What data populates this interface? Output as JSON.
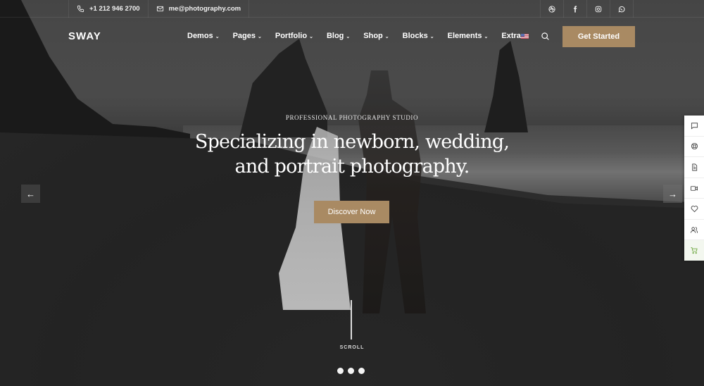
{
  "topbar": {
    "phone": {
      "icon": "phone-icon",
      "text": "+1 212 946 2700"
    },
    "email": {
      "icon": "envelope-icon",
      "text": "me@photography.com"
    },
    "socials": [
      {
        "icon": "dribbble-icon",
        "label": "Dribbble"
      },
      {
        "icon": "facebook-icon",
        "label": "Facebook"
      },
      {
        "icon": "instagram-icon",
        "label": "Instagram"
      },
      {
        "icon": "whatsapp-icon",
        "label": "WhatsApp"
      }
    ]
  },
  "nav": {
    "logo": "SWAY",
    "menu": [
      {
        "label": "Demos"
      },
      {
        "label": "Pages"
      },
      {
        "label": "Portfolio"
      },
      {
        "label": "Blog"
      },
      {
        "label": "Shop"
      },
      {
        "label": "Blocks"
      },
      {
        "label": "Elements"
      },
      {
        "label": "Extra"
      }
    ],
    "chevron": "⌄",
    "language_icon": "us-flag-icon",
    "search_icon": "search-icon",
    "cta_label": "Get Started"
  },
  "hero": {
    "kicker": "PROFESSIONAL PHOTOGRAPHY STUDIO",
    "headline_line1": "Specializing in newborn, wedding,",
    "headline_line2": "and portrait photography.",
    "button_label": "Discover Now",
    "prev_arrow": "←",
    "next_arrow": "→",
    "scroll_label": "SCROLL",
    "slides_count": 3,
    "active_slide": 1
  },
  "side_toolbar": [
    {
      "icon": "chat-icon"
    },
    {
      "icon": "lifebuoy-icon"
    },
    {
      "icon": "document-icon"
    },
    {
      "icon": "video-icon"
    },
    {
      "icon": "heart-icon"
    },
    {
      "icon": "users-icon"
    },
    {
      "icon": "cart-icon"
    }
  ],
  "colors": {
    "accent": "#a98a63",
    "cart_accent": "#6aa53a"
  }
}
